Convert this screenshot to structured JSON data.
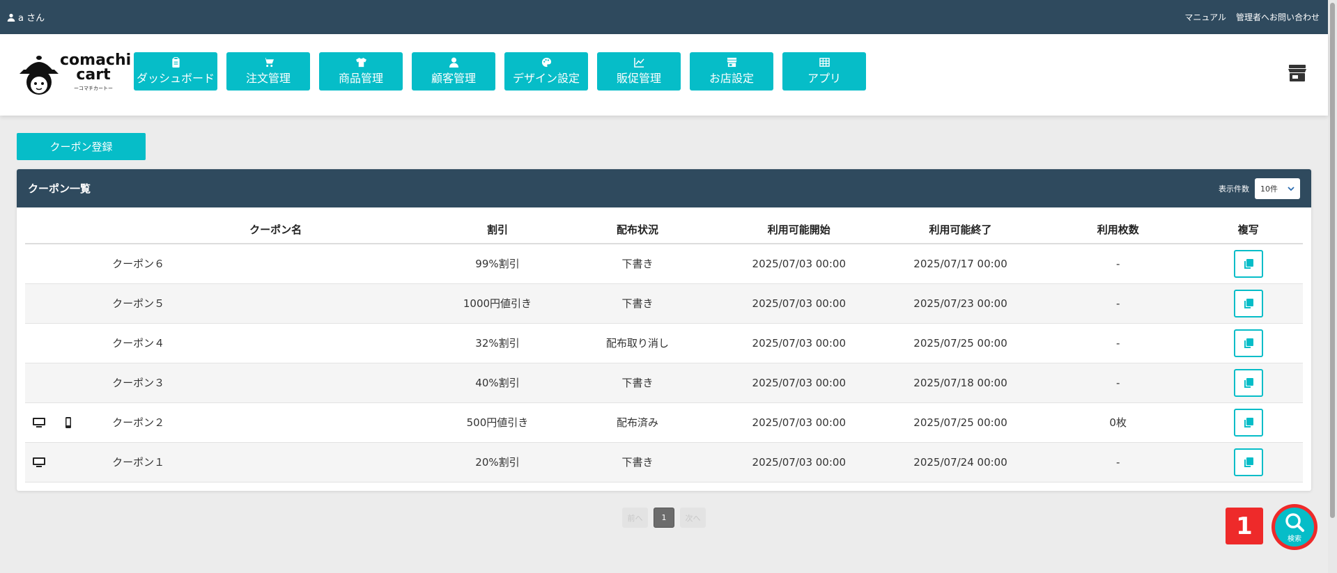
{
  "topbar": {
    "user_label": "a さん",
    "links": [
      "マニュアル",
      "管理者へお問い合わせ"
    ]
  },
  "logo": {
    "line1": "comachi",
    "line2": "cart",
    "sub": "ーコマチカートー"
  },
  "nav": [
    {
      "label": "ダッシュボード",
      "icon": "clipboard-icon"
    },
    {
      "label": "注文管理",
      "icon": "cart-icon"
    },
    {
      "label": "商品管理",
      "icon": "shirt-icon"
    },
    {
      "label": "顧客管理",
      "icon": "user-icon"
    },
    {
      "label": "デザイン設定",
      "icon": "palette-icon"
    },
    {
      "label": "販促管理",
      "icon": "chart-icon"
    },
    {
      "label": "お店設定",
      "icon": "store-icon"
    },
    {
      "label": "アプリ",
      "icon": "grid-icon"
    }
  ],
  "register_button": "クーポン登録",
  "panel": {
    "title": "クーポン一覧",
    "perpage_label": "表示件数",
    "perpage_value": "10件"
  },
  "table": {
    "headers": [
      "クーポン名",
      "割引",
      "配布状況",
      "利用可能開始",
      "利用可能終了",
      "利用枚数",
      "複写"
    ],
    "rows": [
      {
        "pc": false,
        "mobile": false,
        "name": "クーポン６",
        "discount": "99%割引",
        "status": "下書き",
        "start": "2025/07/03 00:00",
        "end": "2025/07/17 00:00",
        "used": "-"
      },
      {
        "pc": false,
        "mobile": false,
        "name": "クーポン５",
        "discount": "1000円値引き",
        "status": "下書き",
        "start": "2025/07/03 00:00",
        "end": "2025/07/23 00:00",
        "used": "-"
      },
      {
        "pc": false,
        "mobile": false,
        "name": "クーポン４",
        "discount": "32%割引",
        "status": "配布取り消し",
        "start": "2025/07/03 00:00",
        "end": "2025/07/25 00:00",
        "used": "-"
      },
      {
        "pc": false,
        "mobile": false,
        "name": "クーポン３",
        "discount": "40%割引",
        "status": "下書き",
        "start": "2025/07/03 00:00",
        "end": "2025/07/18 00:00",
        "used": "-"
      },
      {
        "pc": true,
        "mobile": true,
        "name": "クーポン２",
        "discount": "500円値引き",
        "status": "配布済み",
        "start": "2025/07/03 00:00",
        "end": "2025/07/25 00:00",
        "used": "0枚"
      },
      {
        "pc": true,
        "mobile": false,
        "name": "クーポン１",
        "discount": "20%割引",
        "status": "下書き",
        "start": "2025/07/03 00:00",
        "end": "2025/07/24 00:00",
        "used": "-"
      }
    ]
  },
  "pager": {
    "prev": "前へ",
    "current": "1",
    "next": "次へ"
  },
  "badge": "1",
  "search_fab_label": "検索",
  "colors": {
    "accent": "#06bdc8",
    "header_dark": "#2f4a5e",
    "badge_red": "#ee2a2a"
  }
}
